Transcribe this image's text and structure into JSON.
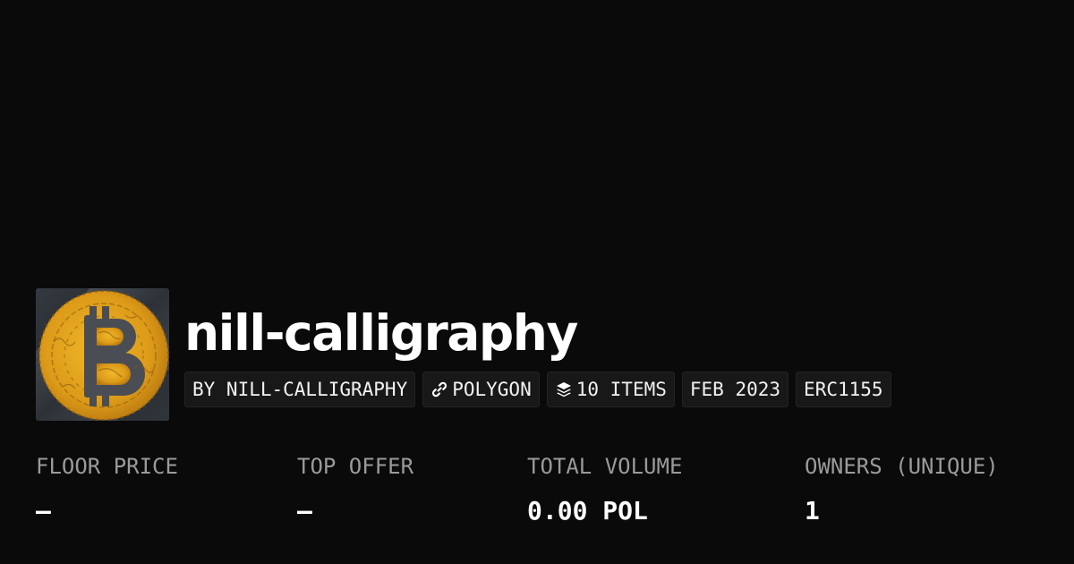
{
  "collection": {
    "name": "nill-calligraphy",
    "avatar_icon": "bitcoin-calligraphy-logo"
  },
  "chips": [
    {
      "label": "BY NILL-CALLIGRAPHY"
    },
    {
      "label": "POLYGON",
      "icon": "link-icon"
    },
    {
      "label": "10 ITEMS",
      "icon": "layers-icon"
    },
    {
      "label": "FEB 2023"
    },
    {
      "label": "ERC1155"
    }
  ],
  "stats": [
    {
      "label": "FLOOR PRICE",
      "value": "–"
    },
    {
      "label": "TOP OFFER",
      "value": "–"
    },
    {
      "label": "TOTAL VOLUME",
      "value": "0.00 POL"
    },
    {
      "label": "OWNERS (UNIQUE)",
      "value": "1"
    }
  ],
  "colors": {
    "background": "#0a0a0a",
    "chip_background": "#181818",
    "label_gray": "#9a9a9a",
    "coin_gold": "#e8a820"
  }
}
